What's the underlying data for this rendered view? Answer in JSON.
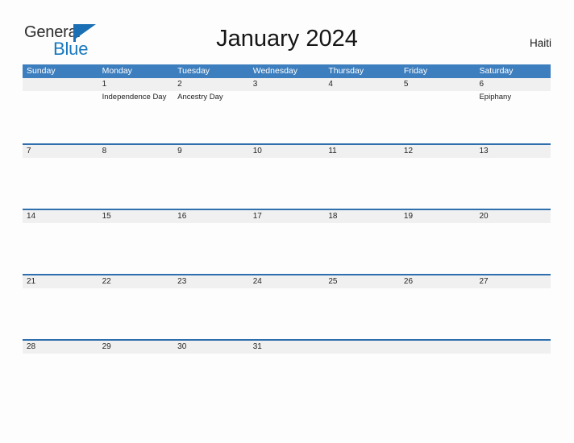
{
  "brand": {
    "name_top": "General",
    "name_bottom": "Blue",
    "accent_color": "#1878be"
  },
  "header": {
    "title": "January 2024",
    "region": "Haiti"
  },
  "theme": {
    "header_blue": "#3d7ebe",
    "row_border_blue": "#2f6fae",
    "date_band_gray": "#f0f0f0",
    "page_background": "#fdfdfd"
  },
  "calendar": {
    "month": "January",
    "year": "2024",
    "weekday_headers": [
      "Sunday",
      "Monday",
      "Tuesday",
      "Wednesday",
      "Thursday",
      "Friday",
      "Saturday"
    ],
    "weeks": [
      {
        "days": [
          {
            "date": "",
            "events": []
          },
          {
            "date": "1",
            "events": [
              "Independence Day"
            ]
          },
          {
            "date": "2",
            "events": [
              "Ancestry Day"
            ]
          },
          {
            "date": "3",
            "events": []
          },
          {
            "date": "4",
            "events": []
          },
          {
            "date": "5",
            "events": []
          },
          {
            "date": "6",
            "events": [
              "Epiphany"
            ]
          }
        ]
      },
      {
        "days": [
          {
            "date": "7",
            "events": []
          },
          {
            "date": "8",
            "events": []
          },
          {
            "date": "9",
            "events": []
          },
          {
            "date": "10",
            "events": []
          },
          {
            "date": "11",
            "events": []
          },
          {
            "date": "12",
            "events": []
          },
          {
            "date": "13",
            "events": []
          }
        ]
      },
      {
        "days": [
          {
            "date": "14",
            "events": []
          },
          {
            "date": "15",
            "events": []
          },
          {
            "date": "16",
            "events": []
          },
          {
            "date": "17",
            "events": []
          },
          {
            "date": "18",
            "events": []
          },
          {
            "date": "19",
            "events": []
          },
          {
            "date": "20",
            "events": []
          }
        ]
      },
      {
        "days": [
          {
            "date": "21",
            "events": []
          },
          {
            "date": "22",
            "events": []
          },
          {
            "date": "23",
            "events": []
          },
          {
            "date": "24",
            "events": []
          },
          {
            "date": "25",
            "events": []
          },
          {
            "date": "26",
            "events": []
          },
          {
            "date": "27",
            "events": []
          }
        ]
      },
      {
        "days": [
          {
            "date": "28",
            "events": []
          },
          {
            "date": "29",
            "events": []
          },
          {
            "date": "30",
            "events": []
          },
          {
            "date": "31",
            "events": []
          },
          {
            "date": "",
            "events": []
          },
          {
            "date": "",
            "events": []
          },
          {
            "date": "",
            "events": []
          }
        ]
      }
    ]
  }
}
